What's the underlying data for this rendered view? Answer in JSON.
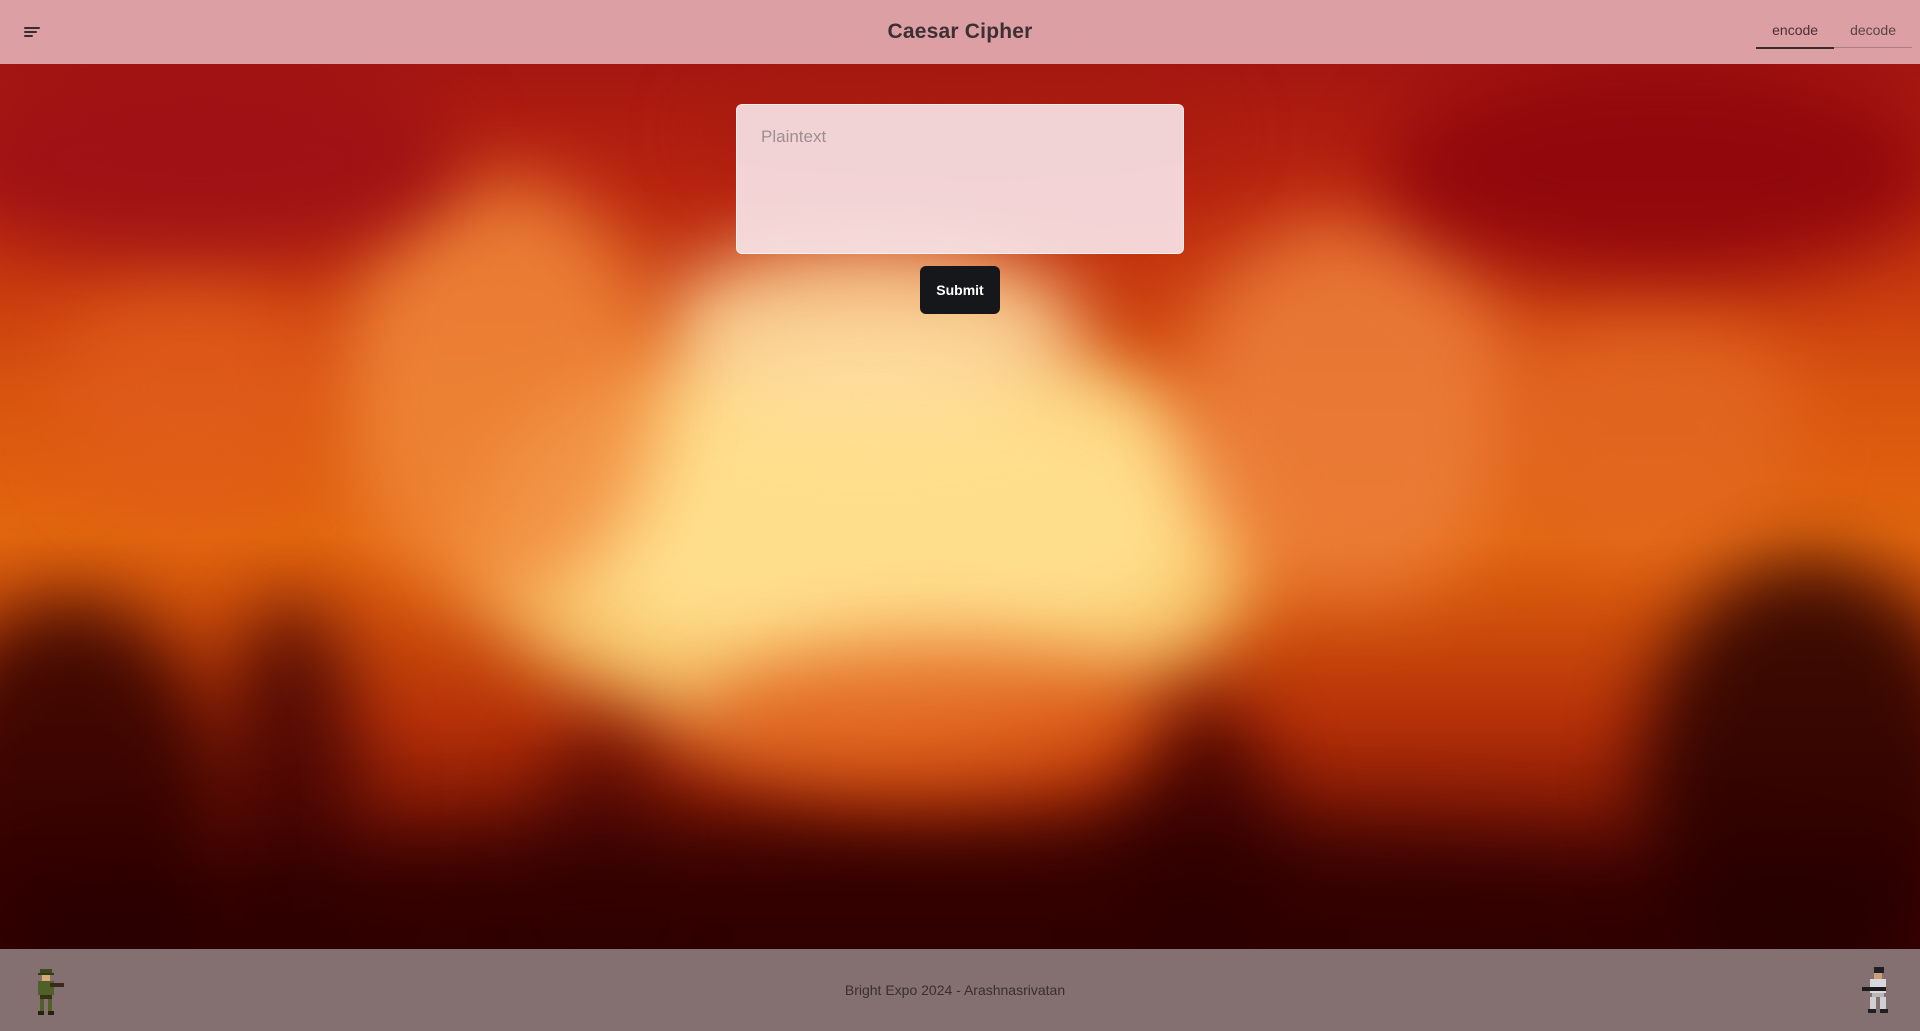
{
  "header": {
    "title": "Caesar Cipher",
    "tabs": [
      {
        "label": "encode",
        "active": true
      },
      {
        "label": "decode",
        "active": false
      }
    ]
  },
  "form": {
    "input_placeholder": "Plaintext",
    "input_value": "",
    "submit_label": "Submit"
  },
  "footer": {
    "text": "Bright Expo 2024 - Arashnasrivatan"
  },
  "icons": {
    "menu": "menu-icon",
    "left_sprite": "soldier-sprite-icon",
    "right_sprite": "soldier-sprite-icon"
  },
  "colors": {
    "header_bg": "#e1aaaf",
    "footer_bg": "#8c787a",
    "submit_bg": "#15171b"
  }
}
